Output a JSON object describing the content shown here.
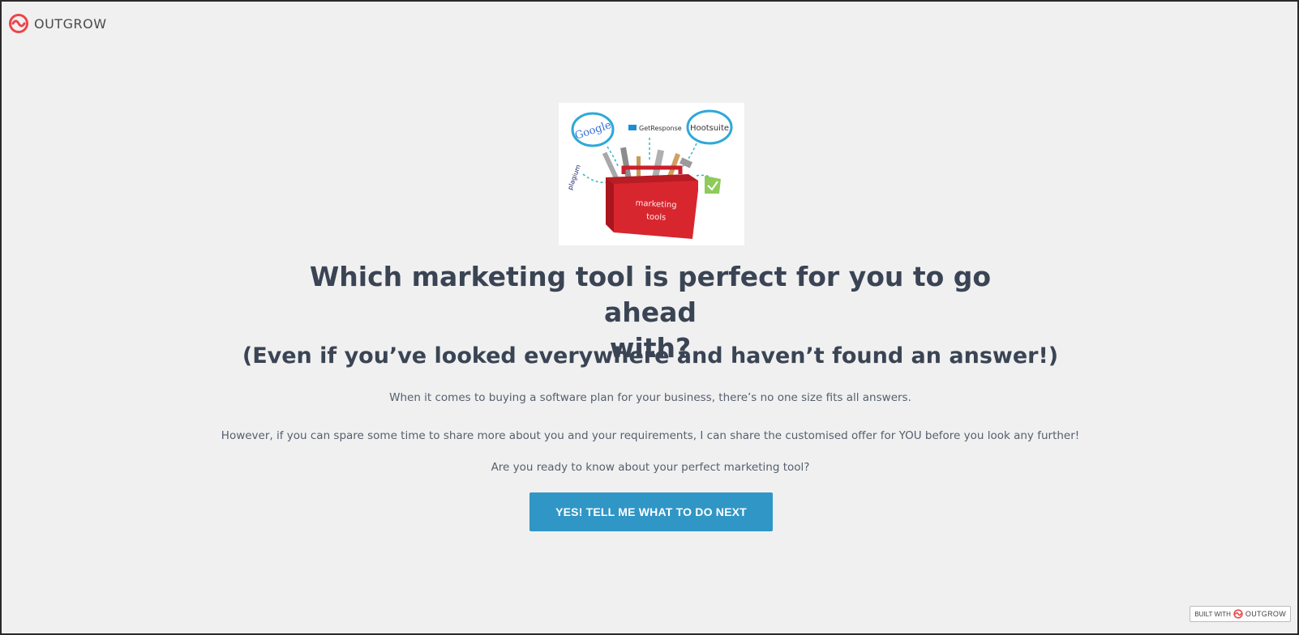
{
  "brand": {
    "name": "OUTGROW",
    "accent_color": "#e8474c"
  },
  "hero": {
    "image_labels": {
      "google": "Google",
      "getresponse": "GetResponse",
      "hootsuite": "Hootsuite",
      "plagium": "plagium",
      "toolbox_label_line1": "marketing",
      "toolbox_label_line2": "tools"
    }
  },
  "content": {
    "headline_line1": "Which marketing tool is perfect for you to go ahead",
    "headline_line2": "with?",
    "subheadline": "(Even if you’ve looked everywhere and haven’t found an answer!)",
    "paragraph1": "When it comes to buying a software plan for your business, there’s no one size fits all answers.",
    "paragraph2": "However, if you can spare some time to share more about you and your requirements, I can share the customised offer for YOU before you look any further!",
    "paragraph3": "Are you ready to know about your perfect marketing tool?"
  },
  "cta": {
    "label": "YES! TELL ME WHAT TO DO NEXT",
    "color": "#3096c6"
  },
  "footer_badge": {
    "prefix": "BUILT WITH",
    "brand": "OUTGROW"
  }
}
